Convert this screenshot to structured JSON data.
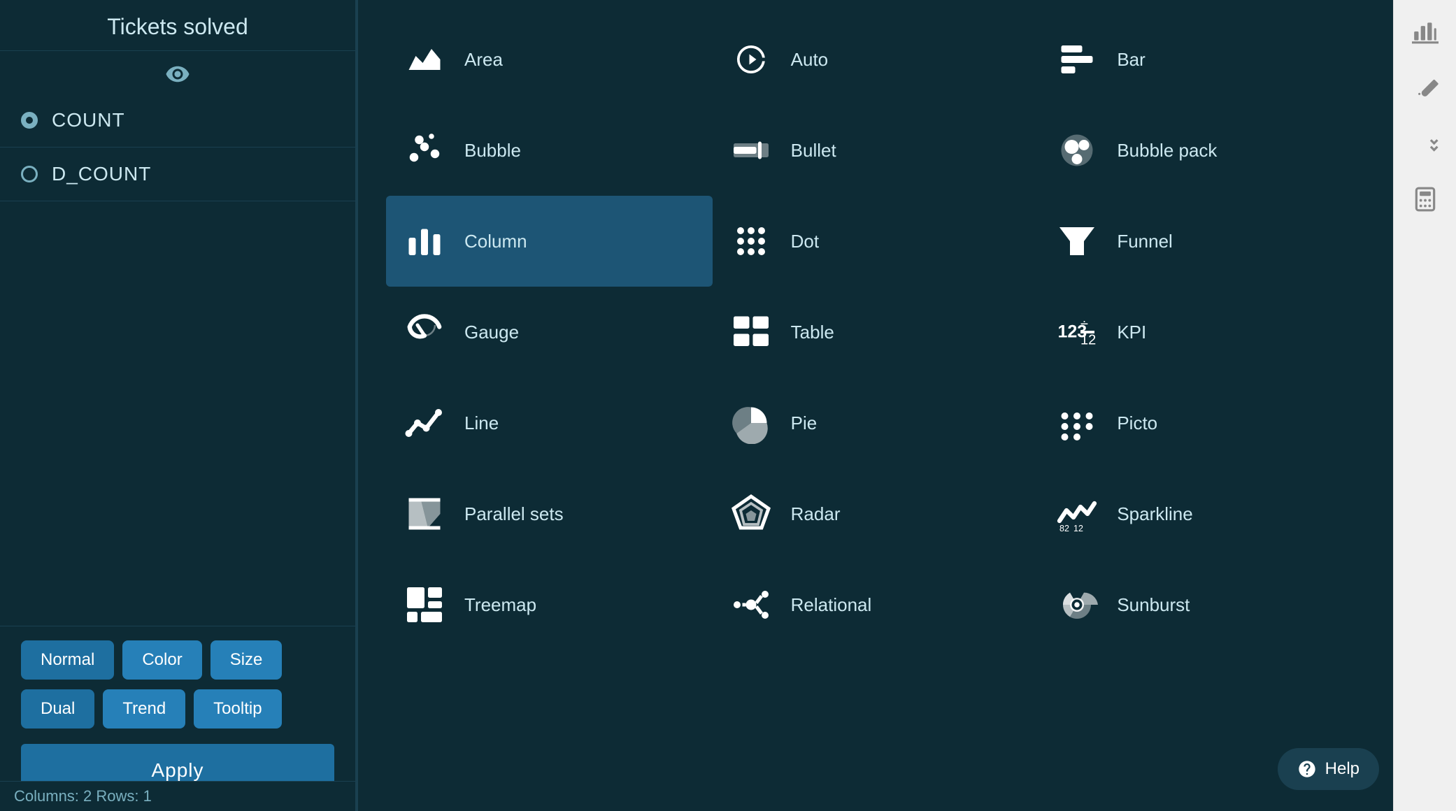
{
  "left_panel": {
    "title": "Tickets solved",
    "fields": [
      {
        "id": "count",
        "label": "COUNT",
        "selected": true
      },
      {
        "id": "dcount",
        "label": "D_COUNT",
        "selected": false
      }
    ],
    "buttons_row1": [
      {
        "id": "normal",
        "label": "Normal",
        "variant": "normal"
      },
      {
        "id": "color",
        "label": "Color",
        "variant": "color"
      },
      {
        "id": "size",
        "label": "Size",
        "variant": "size"
      }
    ],
    "buttons_row2": [
      {
        "id": "dual",
        "label": "Dual",
        "variant": "dual"
      },
      {
        "id": "trend",
        "label": "Trend",
        "variant": "trend"
      },
      {
        "id": "tooltip",
        "label": "Tooltip",
        "variant": "tooltip"
      }
    ],
    "apply_label": "Apply",
    "status": "Columns: 2    Rows: 1"
  },
  "chart_types": [
    {
      "id": "area",
      "label": "Area",
      "icon": "area"
    },
    {
      "id": "auto",
      "label": "Auto",
      "icon": "auto"
    },
    {
      "id": "bar",
      "label": "Bar",
      "icon": "bar"
    },
    {
      "id": "bubble",
      "label": "Bubble",
      "icon": "bubble"
    },
    {
      "id": "bullet",
      "label": "Bullet",
      "icon": "bullet"
    },
    {
      "id": "bubble-pack",
      "label": "Bubble pack",
      "icon": "bubble-pack"
    },
    {
      "id": "column",
      "label": "Column",
      "icon": "column",
      "selected": true
    },
    {
      "id": "dot",
      "label": "Dot",
      "icon": "dot"
    },
    {
      "id": "funnel",
      "label": "Funnel",
      "icon": "funnel"
    },
    {
      "id": "gauge",
      "label": "Gauge",
      "icon": "gauge"
    },
    {
      "id": "table",
      "label": "Table",
      "icon": "table"
    },
    {
      "id": "kpi",
      "label": "KPI",
      "icon": "kpi"
    },
    {
      "id": "line",
      "label": "Line",
      "icon": "line"
    },
    {
      "id": "pie",
      "label": "Pie",
      "icon": "pie"
    },
    {
      "id": "picto",
      "label": "Picto",
      "icon": "picto"
    },
    {
      "id": "parallel-sets",
      "label": "Parallel sets",
      "icon": "parallel-sets"
    },
    {
      "id": "radar",
      "label": "Radar",
      "icon": "radar"
    },
    {
      "id": "sparkline",
      "label": "Sparkline",
      "icon": "sparkline"
    },
    {
      "id": "treemap",
      "label": "Treemap",
      "icon": "treemap"
    },
    {
      "id": "relational",
      "label": "Relational",
      "icon": "relational"
    },
    {
      "id": "sunburst",
      "label": "Sunburst",
      "icon": "sunburst"
    }
  ],
  "right_sidebar": {
    "icons": [
      {
        "id": "chart-icon",
        "label": "chart"
      },
      {
        "id": "brush-icon",
        "label": "brush"
      },
      {
        "id": "sort-icon",
        "label": "sort"
      },
      {
        "id": "calc-icon",
        "label": "calculator"
      }
    ]
  },
  "help_label": "Help"
}
